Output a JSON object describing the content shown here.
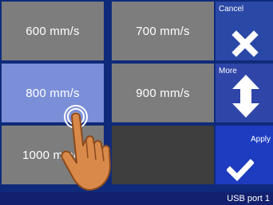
{
  "speed_options": [
    {
      "label": "600 mm/s",
      "selected": false
    },
    {
      "label": "700 mm/s",
      "selected": false
    },
    {
      "label": "800 mm/s",
      "selected": true
    },
    {
      "label": "900 mm/s",
      "selected": false
    },
    {
      "label": "1000 mm/s",
      "selected": false
    }
  ],
  "actions": {
    "cancel_label": "Cancel",
    "more_label": "More",
    "apply_label": "Apply"
  },
  "status": {
    "port": "USB port 1"
  },
  "icons": {
    "cancel": "close-icon",
    "more": "up-down-arrows-icon",
    "apply": "checkmark-icon",
    "touch": "hand-pointer-icon"
  },
  "colors": {
    "background": "#0f2a7a",
    "tile": "#7d7d7d",
    "selected_tile": "#7b8fd8",
    "empty_tile": "#3e3e3e"
  }
}
